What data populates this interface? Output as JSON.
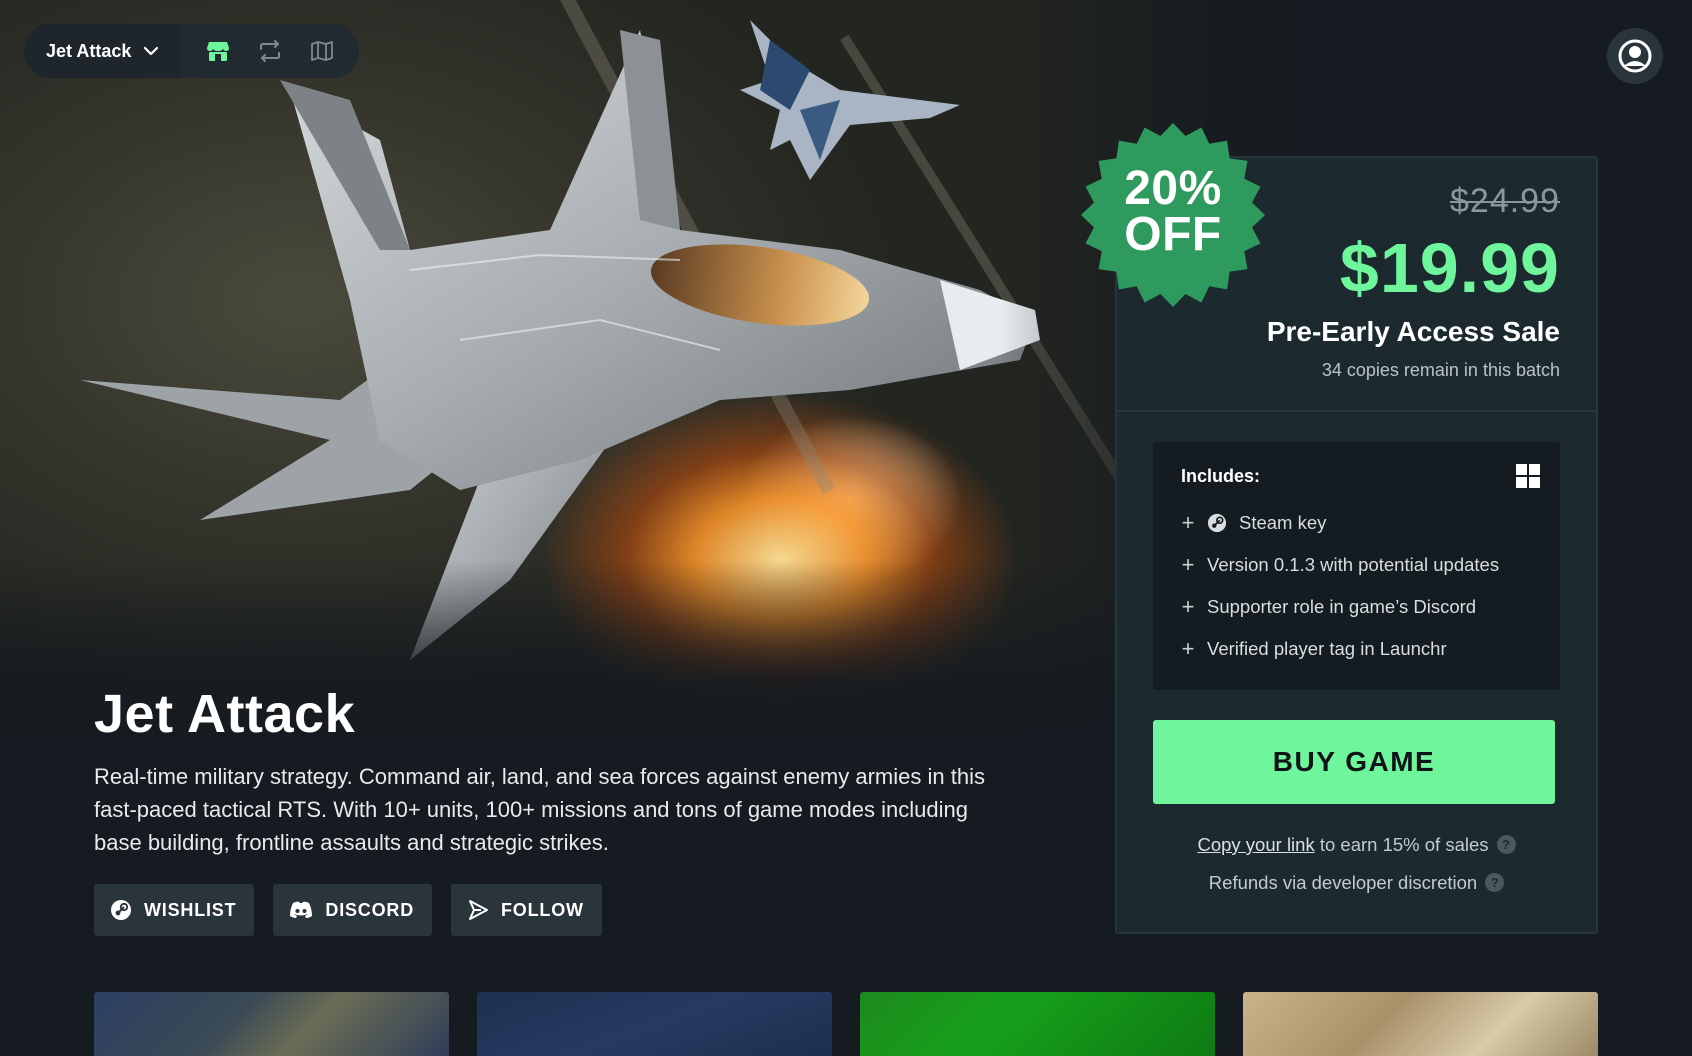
{
  "nav": {
    "game_name": "Jet Attack",
    "icons": [
      "store-icon",
      "swap-icon",
      "map-icon"
    ],
    "active_color": "#6ff59b"
  },
  "game": {
    "title": "Jet Attack",
    "description": "Real-time military strategy. Command air, land, and sea forces against enemy armies in this fast-paced tactical RTS. With 10+ units, 100+ missions and tons of game modes including base building, frontline assaults and strategic strikes."
  },
  "social": {
    "wishlist": "WISHLIST",
    "discord": "DISCORD",
    "follow": "FOLLOW"
  },
  "badge": {
    "line1": "20%",
    "line2": "OFF",
    "color": "#2f9a5e"
  },
  "pricing": {
    "old_price": "$24.99",
    "new_price": "$19.99",
    "sale_name": "Pre-Early Access Sale",
    "copies_remaining": "34 copies remain in this batch",
    "accent_color": "#6ff59b"
  },
  "includes": {
    "title": "Includes:",
    "platform_icon": "windows-icon",
    "items": [
      "Steam key",
      "Version 0.1.3 with potential updates",
      "Supporter role in game’s Discord",
      "Verified player tag in Launchr"
    ]
  },
  "purchase": {
    "buy_label": "BUY GAME",
    "affiliate_link": "Copy your link",
    "affiliate_text": " to earn 15% of sales",
    "refunds": "Refunds via developer discretion",
    "help": "?"
  }
}
